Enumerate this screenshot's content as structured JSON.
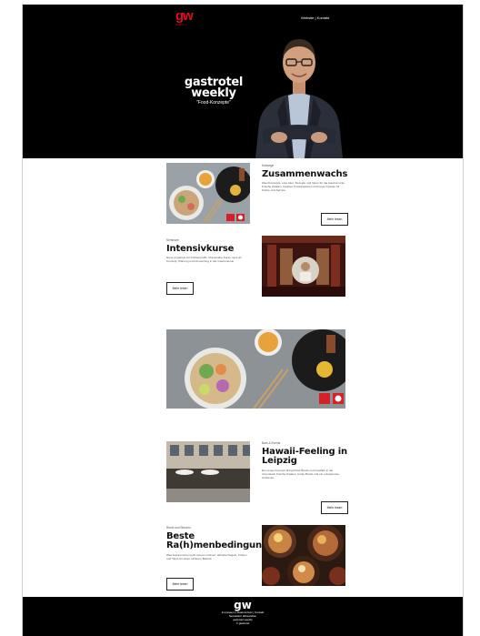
{
  "header": {
    "logo_text": "gw",
    "logo_sub": "weekly",
    "nav_website": "Website",
    "nav_separator": " | ",
    "nav_contact": "Kontakt",
    "title_line1": "gastrotel",
    "title_line2": "weekly",
    "title_line3": "\"Food-Konzepte\""
  },
  "articles": [
    {
      "kicker": "Hotrange",
      "headline": "Zusammenwachs",
      "body": "Zwei Konzepte, eine Idee: Rezepte und Ideen für die Gastronomie. Frische Zutaten, kreative Kombinationen und neue Impulse für Küche und Service.",
      "button": "Mehr lesen"
    },
    {
      "kicker": "Seminare",
      "headline": "Intensivkurse",
      "body": "Neue Angebote für Küchenprofis. Praxisnahe Kurse rund um Konzept, Planung und Umsetzung in der Gastronomie.",
      "button": "Mehr lesen"
    },
    {
      "kicker": "Bars & Events",
      "headline_line1": "Hawaii-Feeling in",
      "headline_line2": "Leipzig",
      "body": "Ein neues Konzept bringt Poké Bowls und Inselflair in die Innenstadt. Frische Zutaten, bunte Bowls und ein entspanntes Ambiente.",
      "button": "Mehr lesen"
    },
    {
      "kicker": "Recht und Steuern",
      "headline_line1": "Beste",
      "headline_line2": "Ra(h)menbedingungen",
      "body": "Was Gastronomen jetzt wissen müssen: aktuelle Regeln, Fristen und Tipps für einen sicheren Betrieb.",
      "button": "Mehr lesen"
    }
  ],
  "footer": {
    "logo": "gw",
    "line1": "Impressum | Datenschutz | Kontakt",
    "line2": "Newsletter abbestellen",
    "line3": "gastrotel weekly",
    "line4": "© gastrotel"
  }
}
